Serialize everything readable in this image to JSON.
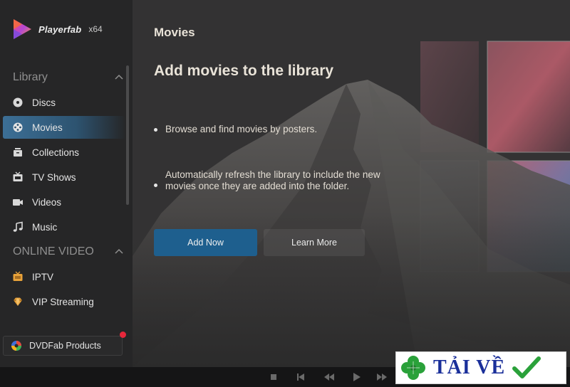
{
  "app": {
    "name": "Playerfab",
    "arch": "x64"
  },
  "sidebar": {
    "library_header": "Library",
    "online_header": "ONLINE VIDEO",
    "library_items": [
      {
        "label": "Discs",
        "icon": "disc-icon"
      },
      {
        "label": "Movies",
        "icon": "film-reel-icon",
        "active": true
      },
      {
        "label": "Collections",
        "icon": "collections-icon"
      },
      {
        "label": "TV Shows",
        "icon": "tv-icon"
      },
      {
        "label": "Videos",
        "icon": "video-icon"
      },
      {
        "label": "Music",
        "icon": "music-note-icon"
      }
    ],
    "online_items": [
      {
        "label": "IPTV",
        "icon": "iptv-icon"
      },
      {
        "label": "VIP Streaming",
        "icon": "vip-diamond-icon"
      }
    ],
    "products_label": "DVDFab Products"
  },
  "main": {
    "page_title": "Movies",
    "headline": "Add movies to the library",
    "bullets": [
      "Browse and find movies by posters.",
      "Automatically refresh the library to include the new movies once they are added into the folder."
    ],
    "add_now_label": "Add Now",
    "learn_more_label": "Learn More"
  },
  "watermark": {
    "text": "TẢI VỀ"
  },
  "colors": {
    "accent": "#1e5f8e",
    "active_item": "#3c6f96",
    "notification": "#e6273b"
  }
}
